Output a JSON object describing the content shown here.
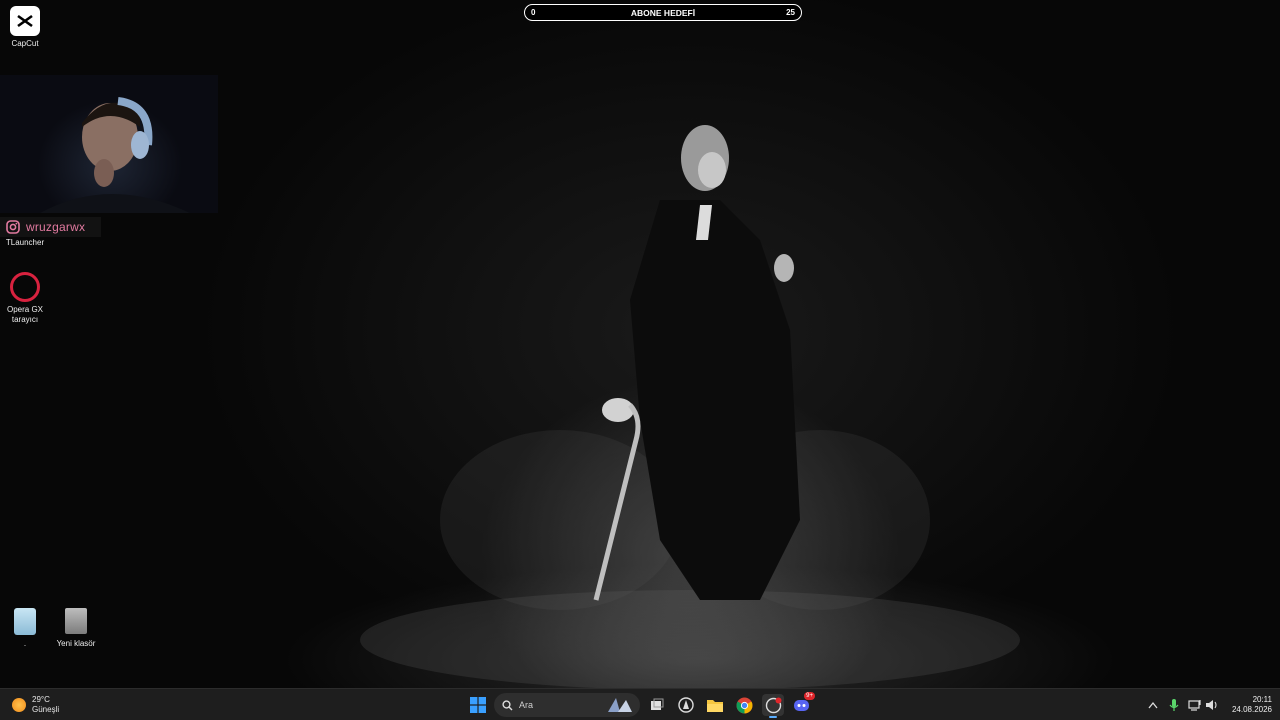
{
  "desktop": {
    "icons": [
      {
        "label": "CapCut"
      },
      {
        "label": "TLauncher"
      },
      {
        "label": "Opera GX\ntarayıcı"
      },
      {
        "label": "."
      },
      {
        "label": "Yeni klasör"
      }
    ]
  },
  "overlay": {
    "goal": {
      "title": "ABONE HEDEFİ",
      "current": "0",
      "target": "25"
    },
    "instagram_handle": "wruzgarwx"
  },
  "taskbar": {
    "weather": {
      "temp": "29°C",
      "condition": "Güneşli"
    },
    "search_placeholder": "Ara",
    "clock": {
      "time": "20:11",
      "date": "24.08.2026"
    },
    "discord_badge": "9+"
  },
  "colors": {
    "taskbar_bg": "#1e1e1e",
    "accent_windows": "#3aa0ff",
    "opera_red": "#d8223f",
    "instagram_pink": "#e27aa0"
  }
}
